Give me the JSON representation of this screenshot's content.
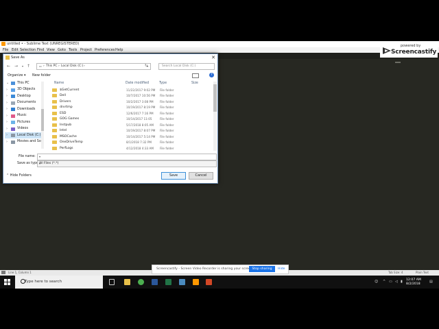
{
  "window": {
    "title": "untitled • - Sublime Text (UNREGISTERED)",
    "menu": [
      "File",
      "Edit",
      "Selection",
      "Find",
      "View",
      "Goto",
      "Tools",
      "Project",
      "Preferences",
      "Help"
    ],
    "status_left": "Line 1, Column 1",
    "status_tab": "Tab Size: 4",
    "status_syntax": "Plain Text"
  },
  "screencastify": {
    "powered": "powered by",
    "brand": "Screencastify"
  },
  "dialog": {
    "title": "Save As",
    "breadcrumb": [
      "This PC",
      "Local Disk (C:)"
    ],
    "search_placeholder": "Search Local Disk (C:)",
    "organize": "Organize ▾",
    "new_folder": "New folder",
    "nav_items": [
      {
        "label": "This PC",
        "icon": "computer-icon"
      },
      {
        "label": "3D Objects",
        "icon": "folder-3d-icon"
      },
      {
        "label": "Desktop",
        "icon": "desktop-icon"
      },
      {
        "label": "Documents",
        "icon": "documents-icon"
      },
      {
        "label": "Downloads",
        "icon": "downloads-icon"
      },
      {
        "label": "Music",
        "icon": "music-icon"
      },
      {
        "label": "Pictures",
        "icon": "pictures-icon"
      },
      {
        "label": "Videos",
        "icon": "videos-icon"
      },
      {
        "label": "Local Disk (C:)",
        "icon": "drive-icon"
      },
      {
        "label": "Movies and Sou",
        "icon": "drive-icon"
      }
    ],
    "columns": {
      "name": "Name",
      "date": "Date modified",
      "type": "Type",
      "size": "Size"
    },
    "files": [
      {
        "name": "$GetCurrent",
        "date": "11/22/2017 9:02 PM",
        "type": "File folder"
      },
      {
        "name": "Dell",
        "date": "10/7/2017 10:56 PM",
        "type": "File folder"
      },
      {
        "name": "Drivers",
        "date": "10/2/2017 3:08 PM",
        "type": "File folder"
      },
      {
        "name": "drvrtmp",
        "date": "10/19/2017 8:19 PM",
        "type": "File folder"
      },
      {
        "name": "ESD",
        "date": "12/6/2017 7:16 PM",
        "type": "File folder"
      },
      {
        "name": "GOG Games",
        "date": "10/14/2017 11:05",
        "type": "File folder"
      },
      {
        "name": "Instpub",
        "date": "5/17/2018 8:05 AM",
        "type": "File folder"
      },
      {
        "name": "Intel",
        "date": "10/19/2017 8:07 PM",
        "type": "File folder"
      },
      {
        "name": "MSOCache",
        "date": "10/14/2017 5:14 PM",
        "type": "File folder"
      },
      {
        "name": "OneDriveTemp",
        "date": "8/1/2018 7:32 PM",
        "type": "File folder"
      },
      {
        "name": "PerfLogs",
        "date": "4/12/2018 4:33 AM",
        "type": "File folder"
      }
    ],
    "file_name_label": "File name:",
    "file_name_value": "",
    "save_type_label": "Save as type:",
    "save_type_value": "All Files (*.*)",
    "hide_folders": "Hide Folders",
    "save": "Save",
    "cancel": "Cancel"
  },
  "sharebar": {
    "text": "Screencastify - Screen Video Recorder is sharing your screen.",
    "stop": "Stop sharing",
    "hide": "Hide"
  },
  "taskbar": {
    "search_placeholder": "Type here to search",
    "time": "12:07 AM",
    "date": "8/2/2018"
  },
  "colors": {
    "editor_bg": "#272822",
    "accent": "#1a73e8",
    "folder": "#e8c04a"
  }
}
